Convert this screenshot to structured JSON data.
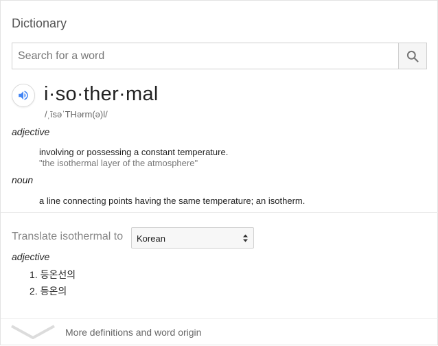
{
  "dictionary": {
    "title": "Dictionary",
    "search": {
      "placeholder": "Search for a word",
      "value": ""
    },
    "icons": {
      "search": "search-icon",
      "speaker": "speaker-icon",
      "more": "chevron-down-icon"
    },
    "colors": {
      "speaker_blue": "#4285f4",
      "search_icon": "#757575"
    },
    "entry": {
      "headword": "i·so·ther·mal",
      "phonetic": "/ˌīsəˈTHərm(ə)l/",
      "senses": [
        {
          "pos": "adjective",
          "definition": "involving or possessing a constant temperature.",
          "example": "\"the isothermal layer of the atmosphere\""
        },
        {
          "pos": "noun",
          "definition": "a line connecting points having the same temperature; an isotherm."
        }
      ]
    },
    "translate": {
      "label": "Translate isothermal to",
      "selected_language": "Korean",
      "pos": "adjective",
      "items": [
        "1.  등온선의",
        "2.  등온의"
      ]
    },
    "more_link": "More definitions and word origin"
  }
}
